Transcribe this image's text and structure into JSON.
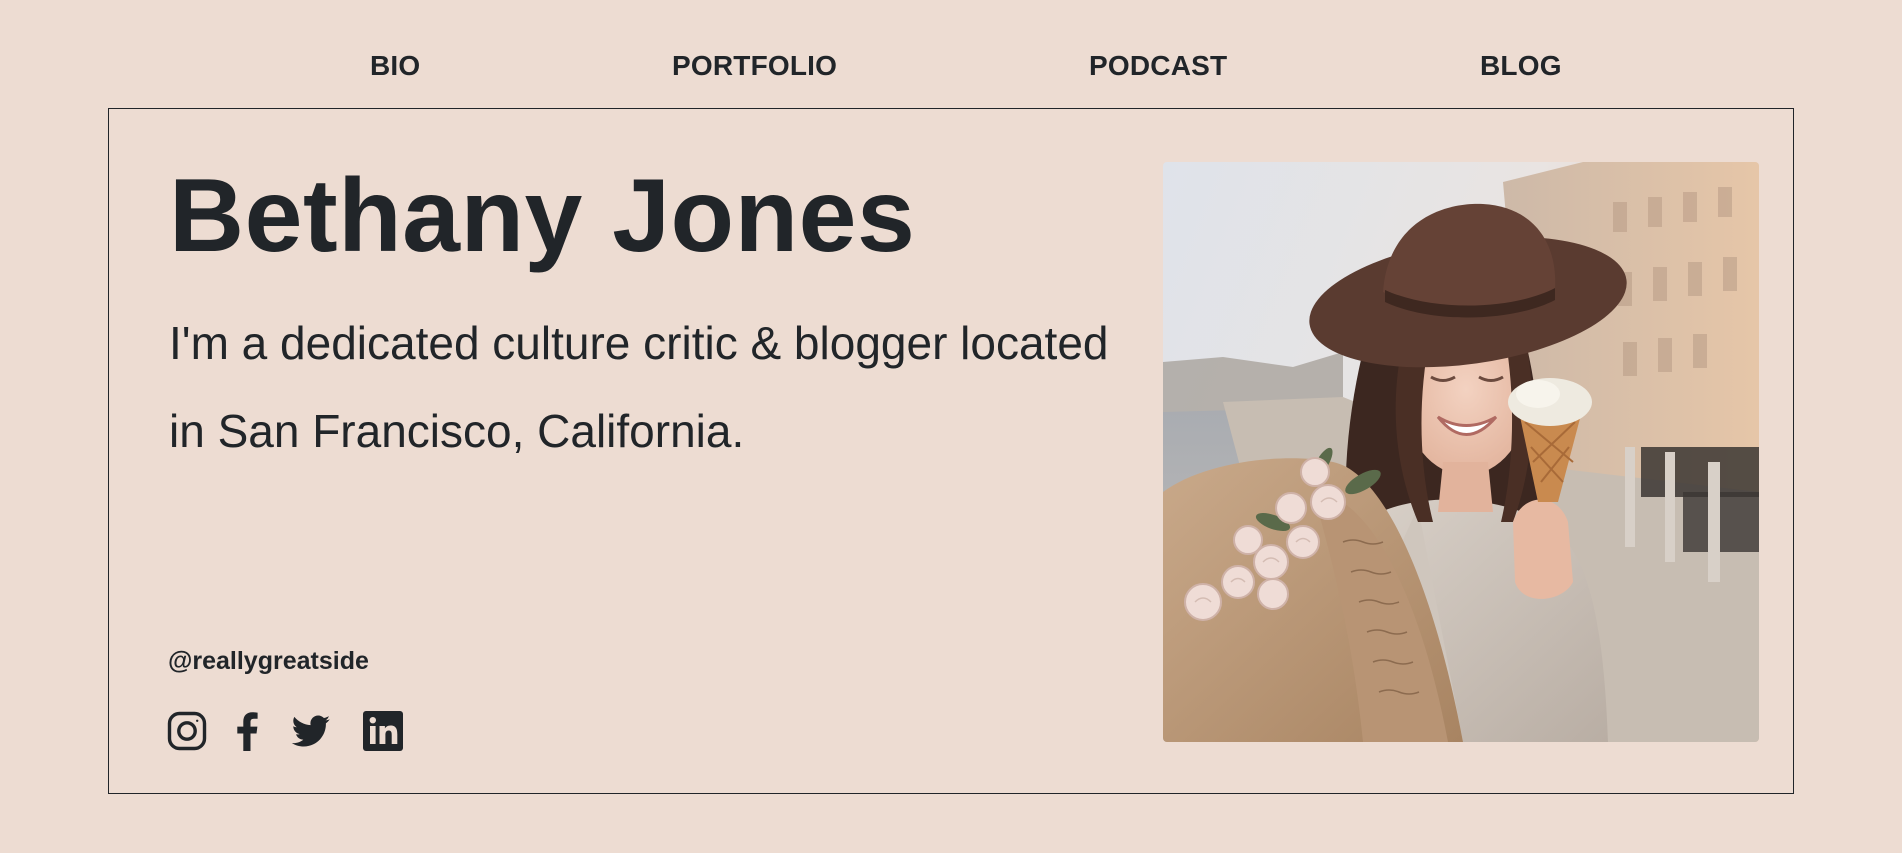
{
  "nav": {
    "items": [
      {
        "label": "BIO"
      },
      {
        "label": "PORTFOLIO"
      },
      {
        "label": "PODCAST"
      },
      {
        "label": "BLOG"
      }
    ]
  },
  "hero": {
    "name": "Bethany Jones",
    "tagline": "I'm a dedicated culture critic & blogger located in San Francisco, California.",
    "handle": "@reallygreatside",
    "photo_alt": "Smiling woman in a brown hat holding flowers and an ice cream cone"
  },
  "socials": [
    {
      "icon": "instagram-icon"
    },
    {
      "icon": "facebook-icon"
    },
    {
      "icon": "twitter-icon"
    },
    {
      "icon": "linkedin-icon"
    }
  ],
  "colors": {
    "background": "#eddcd2",
    "text": "#212529",
    "border": "#212529"
  }
}
